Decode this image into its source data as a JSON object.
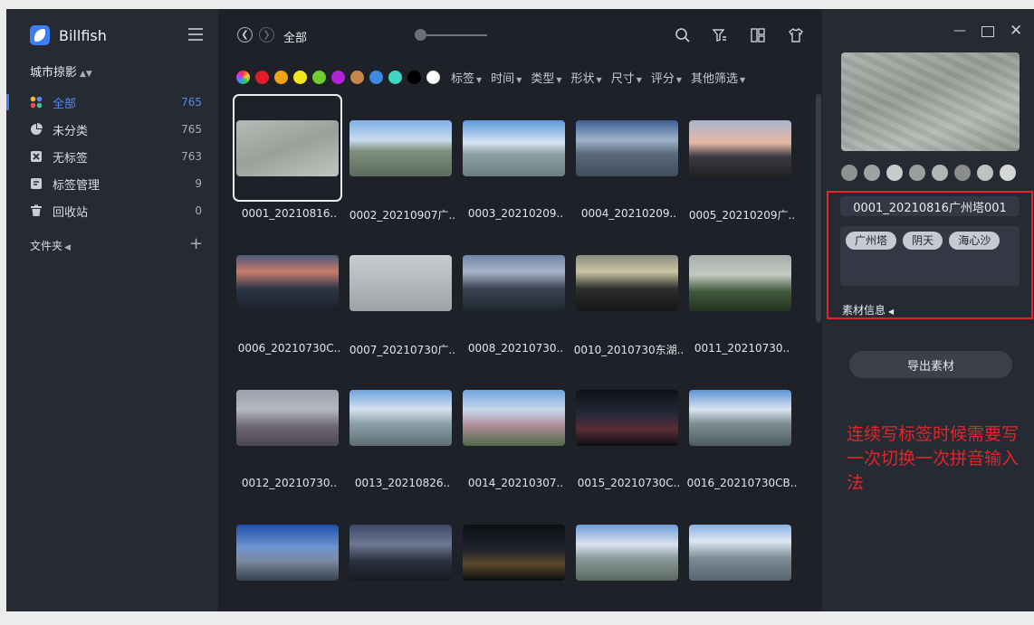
{
  "app": {
    "name": "Billfish"
  },
  "sidebar": {
    "library": "城市掠影",
    "items": [
      {
        "label": "全部",
        "count": "765",
        "icon": "grid-dots-icon",
        "active": true
      },
      {
        "label": "未分类",
        "count": "765",
        "icon": "pie-chart-icon"
      },
      {
        "label": "无标签",
        "count": "763",
        "icon": "no-tag-icon"
      },
      {
        "label": "标签管理",
        "count": "9",
        "icon": "tag-manage-icon"
      },
      {
        "label": "回收站",
        "count": "0",
        "icon": "trash-icon"
      }
    ],
    "folder_label": "文件夹",
    "folder_add": "+"
  },
  "toolbar": {
    "breadcrumb": "全部"
  },
  "filters": {
    "colors": [
      "#e21b28",
      "#f2a313",
      "#f5e51b",
      "#6fcd2c",
      "#b322d8",
      "#c7864a",
      "#3f8be2",
      "#3fd7c3",
      "#000000",
      "#ffffff"
    ],
    "labels": [
      "标签",
      "时间",
      "类型",
      "形状",
      "尺寸",
      "评分",
      "其他筛选"
    ]
  },
  "files": [
    {
      "name": "0001_20210816..",
      "selected": true,
      "scene": "fog"
    },
    {
      "name": "0002_20210907广..",
      "scene": "day-tower"
    },
    {
      "name": "0003_20210209..",
      "scene": "bright-river"
    },
    {
      "name": "0004_20210209..",
      "scene": "cloudy-city"
    },
    {
      "name": "0005_20210209广..",
      "scene": "sunset"
    },
    {
      "name": "0006_20210730C..",
      "scene": "dusk-city"
    },
    {
      "name": "0007_20210730广..",
      "scene": "mist-tower"
    },
    {
      "name": "0008_20210730..",
      "scene": "evening-bridge"
    },
    {
      "name": "0010_2010730东湖..",
      "scene": "dark-sunset"
    },
    {
      "name": "0011_20210730..",
      "scene": "green-river"
    },
    {
      "name": "0012_20210730..",
      "scene": "haze-city"
    },
    {
      "name": "0013_20210826..",
      "scene": "river-day"
    },
    {
      "name": "0014_20210307..",
      "scene": "blossom"
    },
    {
      "name": "0015_20210730C..",
      "scene": "night-lights"
    },
    {
      "name": "0016_20210730CB..",
      "scene": "bridge-day"
    },
    {
      "name": "",
      "scene": "blue-bridge"
    },
    {
      "name": "",
      "scene": "dusk-river"
    },
    {
      "name": "",
      "scene": "night-bridge"
    },
    {
      "name": "",
      "scene": "tower-river"
    },
    {
      "name": "",
      "scene": "river-blocks"
    }
  ],
  "inspector": {
    "palette": [
      "#8e9290",
      "#a0a3a1",
      "#c9cbca",
      "#9b9e9c",
      "#b3b6b4",
      "#8a8d8b",
      "#c0c2c1",
      "#d5d7d6"
    ],
    "file_name": "0001_20210816广州塔001",
    "tags": [
      "广州塔",
      "阴天",
      "海心沙"
    ],
    "info_label": "素材信息",
    "export_label": "导出素材",
    "annotation": "连续写标签时候需要写一次切换一次拼音输入法"
  }
}
